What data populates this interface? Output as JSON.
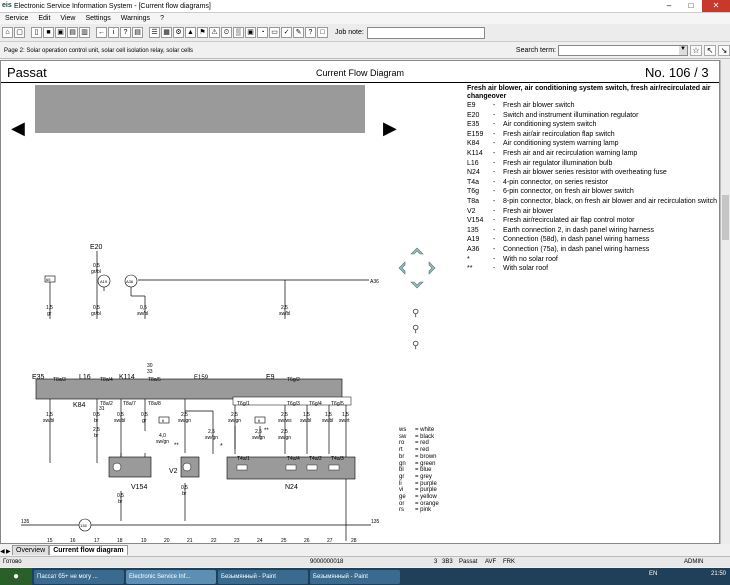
{
  "window": {
    "title": "Electronic Service Information System - [Current flow diagrams]",
    "app_icon": "eis"
  },
  "menu": [
    "Service",
    "Edit",
    "View",
    "Settings",
    "Warnings",
    "?"
  ],
  "toolbar": {
    "job_note_label": "Job note:"
  },
  "pathbar": {
    "path": "Page 2: Solar operation control unit, solar cell isolation relay, solar cells",
    "search_label": "Search term:"
  },
  "doc": {
    "model": "Passat",
    "title": "Current Flow Diagram",
    "number": "No.  106 / 3",
    "legend_title": "Fresh air blower, air conditioning system switch, fresh air/recirculated air changeover",
    "legend": [
      {
        "code": "E9",
        "desc": "Fresh air blower switch"
      },
      {
        "code": "E20",
        "desc": "Switch and instrument illumination regulator"
      },
      {
        "code": "E35",
        "desc": "Air conditioning system switch"
      },
      {
        "code": "E159",
        "desc": "Fresh air/air recirculation flap switch"
      },
      {
        "code": "K84",
        "desc": "Air conditioning system warning lamp"
      },
      {
        "code": "K114",
        "desc": "Fresh air and air recirculation warning lamp"
      },
      {
        "code": "L16",
        "desc": "Fresh air regulator illumination bulb"
      },
      {
        "code": "N24",
        "desc": "Fresh air blower series resistor with overheating fuse"
      },
      {
        "code": "T4a",
        "desc": "4-pin connector, on series resistor"
      },
      {
        "code": "T6g",
        "desc": "6-pin connector, on fresh air blower switch"
      },
      {
        "code": "T8a",
        "desc": "8-pin connector, black, on fresh air blower and air recirculation switch"
      },
      {
        "code": "V2",
        "desc": "Fresh air blower"
      },
      {
        "code": "V154",
        "desc": "Fresh air/recirculated air flap control motor"
      },
      {
        "code": "135",
        "desc": "Earth connection 2, in dash panel wiring harness"
      },
      {
        "code": "A19",
        "desc": "Connection (58d), in dash panel wiring harness"
      },
      {
        "code": "A36",
        "desc": "Connection (75a), in dash panel wiring harness"
      },
      {
        "code": "*",
        "desc": "With no solar roof"
      },
      {
        "code": "**",
        "desc": "With solar roof"
      }
    ],
    "colors": [
      {
        "c": "ws",
        "n": "white"
      },
      {
        "c": "sw",
        "n": "black"
      },
      {
        "c": "ro",
        "n": "red"
      },
      {
        "c": "rt",
        "n": "red"
      },
      {
        "c": "br",
        "n": "brown"
      },
      {
        "c": "gn",
        "n": "green"
      },
      {
        "c": "bl",
        "n": "blue"
      },
      {
        "c": "gr",
        "n": "grey"
      },
      {
        "c": "li",
        "n": "purple"
      },
      {
        "c": "vi",
        "n": "purple"
      },
      {
        "c": "ge",
        "n": "yellow"
      },
      {
        "c": "or",
        "n": "orange"
      },
      {
        "c": "rs",
        "n": "pink"
      }
    ],
    "diagram": {
      "labels": {
        "E20": "E20",
        "E35": "E35",
        "L16": "L16",
        "K114": "K114",
        "E159": "E159",
        "E9": "E9",
        "K84": "K84",
        "V154": "V154",
        "V2": "V2",
        "N24": "N24",
        "A36": "A36",
        "A19": "A19",
        "n135": "135",
        "n65": "65",
        "n6a": "6",
        "n6b": "6",
        "T8a4": "T8a/4",
        "T8a3": "T8a/3",
        "T8a5": "T8a/5",
        "T8a7": "T8a/7",
        "T8a8": "T8a/8",
        "T8a2": "T8a/2",
        "T6g2": "T6g/2",
        "T6g1": "T6g/1",
        "T6g3": "T6g/3",
        "T6g4": "T6g/4",
        "T6g5": "T6g/5",
        "T4a1": "T4a/1",
        "T4a4": "T4a/4",
        "T4a2": "T4a/2",
        "T4a3": "T4a/3",
        "w1": "0,5",
        "w1c": "gr/bl",
        "w2": "0,5",
        "w2c": "gr/bl",
        "w3": "1,5",
        "w3c": "gr",
        "w4": "0,5",
        "w4c": "sw/bl",
        "w5": "2,5",
        "w5c": "sw/bl",
        "w6": "1,5",
        "w6c": "sw/bl",
        "w7": "0,5",
        "w7c": "br",
        "w8": "0,5",
        "w8c": "sw/bl",
        "w9": "0,5",
        "w9c": "gr",
        "w10": "2,5",
        "w10c": "sw/gn",
        "w11": "2,5",
        "w11c": "sw/gn",
        "w12": "2,5",
        "w12c": "sw/ws",
        "w13": "1,5",
        "w13c": "sw/bl",
        "w14": "1,5",
        "w14c": "sw/bl",
        "w15": "1,5",
        "w15c": "sw/rt",
        "w16": "4,0",
        "w16c": "sw/gn",
        "w17": "2,5",
        "w17c": "sw/gn",
        "w18": "0,5",
        "w18c": "br",
        "w19": "0,5",
        "w19c": "br",
        "w20": "2,5",
        "w20c": "br",
        "w21": "2,5",
        "w21c": "sw/gn",
        "w22": "2,5",
        "w22c": "sw/gn",
        "n31": "31",
        "n33": "33",
        "n30": "30",
        "star": "*",
        "dstar": "**",
        "dstar2": "**",
        "ax": [
          "15",
          "16",
          "17",
          "18",
          "19",
          "20",
          "21",
          "22",
          "23",
          "24",
          "25",
          "26",
          "27",
          "28"
        ]
      }
    }
  },
  "tabs": [
    "Overview",
    "Current flow diagram"
  ],
  "status": {
    "ready": "Готово",
    "code": "9000000018",
    "c1": "3",
    "c2": "3B3",
    "c3": "Passat",
    "c4": "AVF",
    "c5": "FRK",
    "user": "ADMIN"
  },
  "taskbar": {
    "tasks": [
      "Пассат б5+ не могу ...",
      "Electronic Service Inf...",
      "Безымянный - Paint",
      "Безымянный - Paint"
    ],
    "lang": "EN",
    "time": "21:50"
  }
}
